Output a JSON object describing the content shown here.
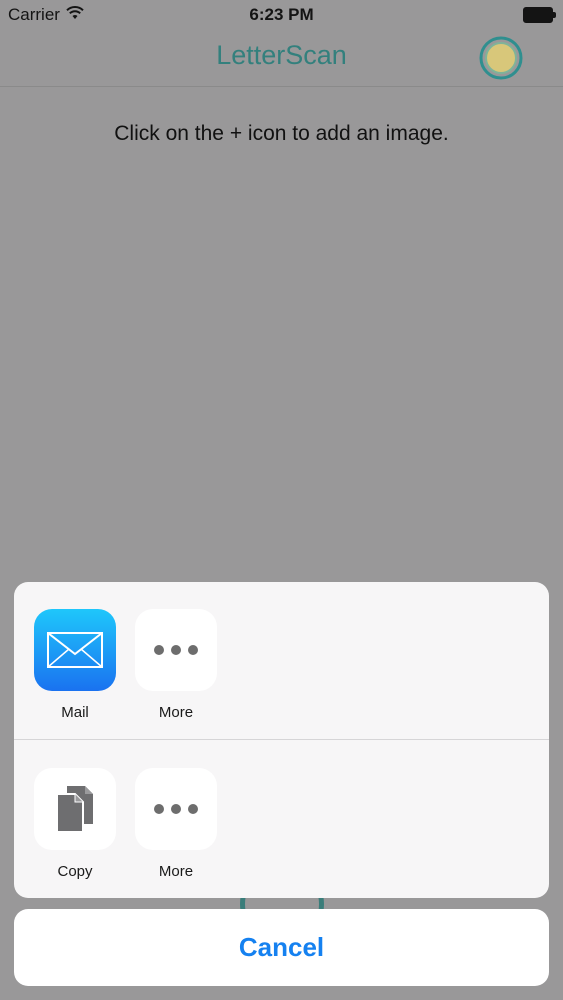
{
  "status_bar": {
    "carrier": "Carrier",
    "time": "6:23 PM"
  },
  "nav": {
    "title": "LetterScan"
  },
  "content": {
    "hint": "Click on the + icon to add an image."
  },
  "share_sheet": {
    "share_row": [
      {
        "label": "Mail",
        "icon": "mail-icon"
      },
      {
        "label": "More",
        "icon": "more-icon"
      }
    ],
    "action_row": [
      {
        "label": "Copy",
        "icon": "copy-icon"
      },
      {
        "label": "More",
        "icon": "more-icon"
      }
    ],
    "cancel_label": "Cancel"
  },
  "colors": {
    "dimmed_background": "#999899",
    "title_teal": "#33807d",
    "cancel_blue": "#1581f0",
    "mail_gradient_top": "#1fc7fb",
    "mail_gradient_bottom": "#1a72f0"
  }
}
